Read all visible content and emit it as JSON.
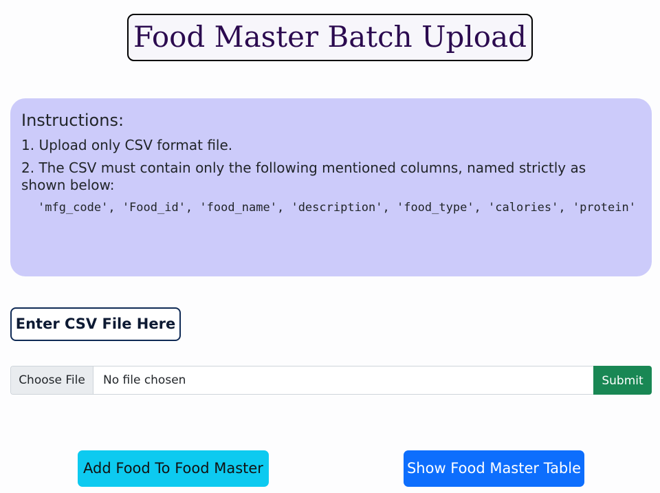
{
  "header": {
    "title": "Food Master Batch Upload"
  },
  "instructions": {
    "heading": "Instructions:",
    "line1": "1. Upload only CSV format file.",
    "line2": "2. The CSV must contain only the following mentioned columns, named strictly as shown below:",
    "columns": "'mfg_code', 'Food_id', 'food_name', 'description', 'food_type', 'calories', 'protein'"
  },
  "upload": {
    "label": "Enter CSV File Here",
    "choose_file": "Choose File",
    "no_file": "No file chosen",
    "submit": "Submit"
  },
  "actions": {
    "add_food": "Add Food To Food Master",
    "show_table": "Show Food Master Table"
  },
  "colors": {
    "instructions_bg": "#cccbfa",
    "submit_bg": "#198754",
    "add_food_bg": "#0dcaf0",
    "show_table_bg": "#0d6efd"
  }
}
